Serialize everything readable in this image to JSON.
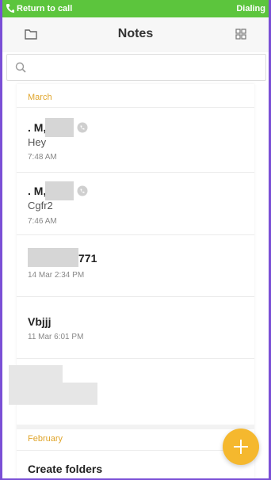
{
  "status_bar": {
    "return_label": "Return to call",
    "state_label": "Dialing"
  },
  "header": {
    "title": "Notes"
  },
  "search": {
    "placeholder": ""
  },
  "sections": [
    {
      "label": "March",
      "notes": [
        {
          "title": ". M,",
          "body": "Hey",
          "time": "7:48 AM"
        },
        {
          "title": ". M,",
          "body": "Cgfr2",
          "time": "7:46 AM"
        },
        {
          "title": "771",
          "body": "",
          "time": "14 Mar 2:34 PM"
        },
        {
          "title": "Vbjjj",
          "body": "",
          "time": "11 Mar 6:01 PM"
        }
      ]
    },
    {
      "label": "February",
      "notes": [
        {
          "title": "Create folders",
          "body": "",
          "time": ""
        }
      ]
    }
  ],
  "colors": {
    "accent": "#e0a52b",
    "call_bar": "#5cc53d",
    "fab": "#f5b82e"
  },
  "icons": [
    "phone-icon",
    "folder-icon",
    "grid-view-icon",
    "search-icon",
    "clock-icon",
    "plus-icon"
  ]
}
